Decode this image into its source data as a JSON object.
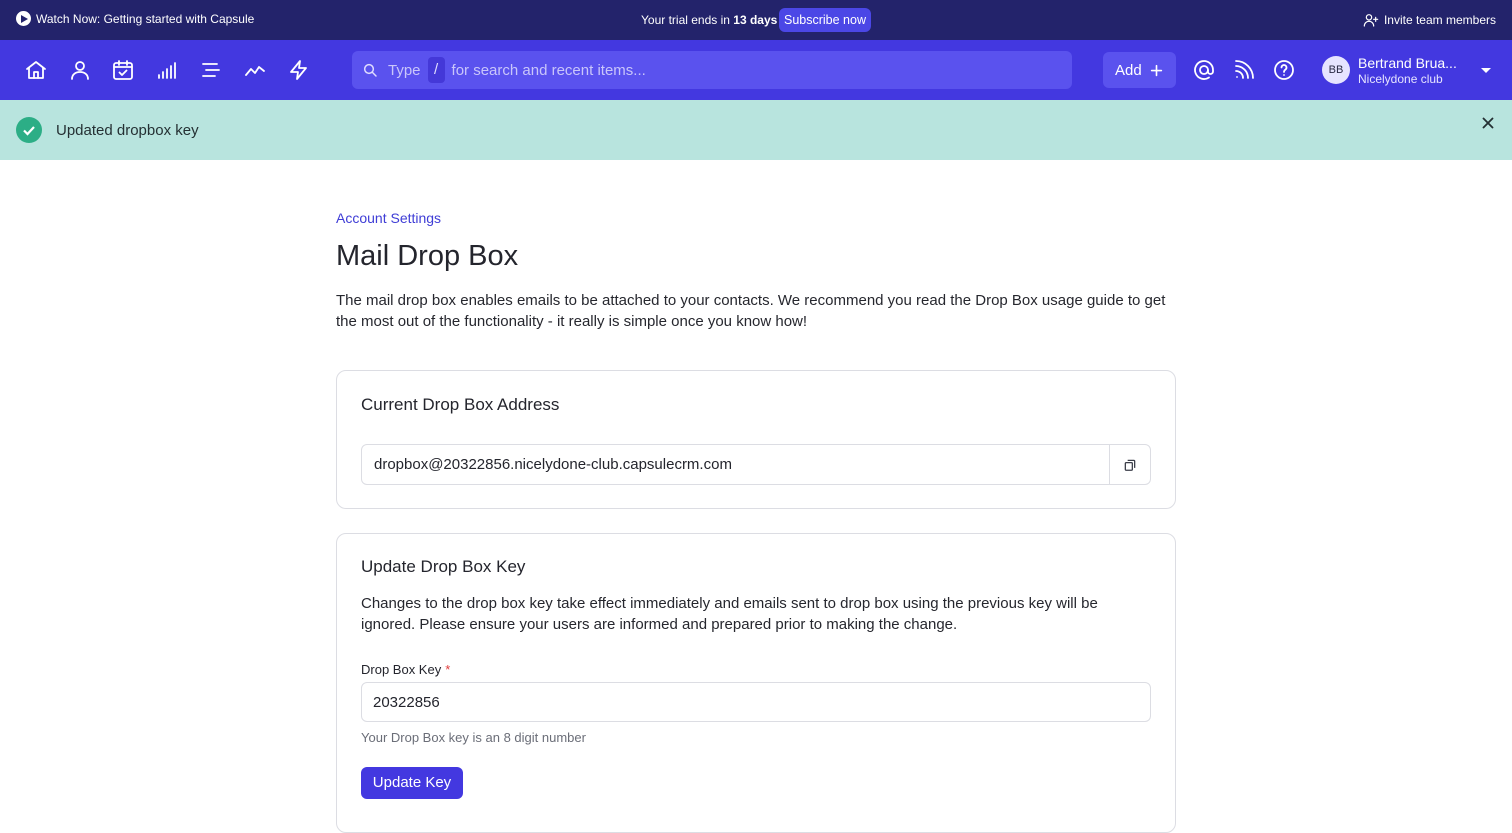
{
  "promo": {
    "watch_label": "Watch Now: Getting started with Capsule",
    "trial_prefix": "Your trial ends in ",
    "trial_days": "13 days",
    "subscribe_label": "Subscribe now",
    "invite_label": "Invite team members"
  },
  "nav": {
    "icons": [
      "home-icon",
      "person-icon",
      "calendar-check-icon",
      "bar-chart-icon",
      "list-icon",
      "trend-icon",
      "bolt-icon"
    ],
    "search": {
      "prefix": "Type",
      "slash": "/",
      "suffix": "for search and recent items..."
    },
    "add_label": "Add",
    "right_icons": [
      "at-icon",
      "feed-icon",
      "help-icon"
    ],
    "user": {
      "initials": "BB",
      "name": "Bertrand Brua...",
      "org": "Nicelydone club"
    }
  },
  "flash": {
    "message": "Updated dropbox key"
  },
  "page": {
    "breadcrumb": "Account Settings",
    "title": "Mail Drop Box",
    "intro": "The mail drop box enables emails to be attached to your contacts. We recommend you read the Drop Box usage guide to get the most out of the functionality - it really is simple once you know how!"
  },
  "current_card": {
    "heading": "Current Drop Box Address",
    "address": "dropbox@20322856.nicelydone-club.capsulecrm.com"
  },
  "update_card": {
    "heading": "Update Drop Box Key",
    "description": "Changes to the drop box key take effect immediately and emails sent to drop box using the previous key will be ignored. Please ensure your users are informed and prepared prior to making the change.",
    "field_label": "Drop Box Key",
    "required_mark": "*",
    "key_value": "20322856",
    "help": "Your Drop Box key is an 8 digit number",
    "button_label": "Update Key"
  },
  "colors": {
    "promo_bg": "#23236b",
    "nav_bg": "#4338e0",
    "flash_bg": "#b8e4de",
    "success": "#2cae86",
    "accent": "#4338e0"
  }
}
